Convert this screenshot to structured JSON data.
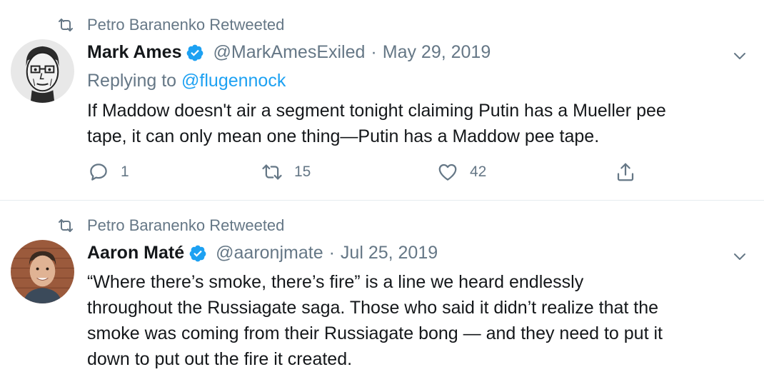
{
  "tweets": [
    {
      "retweeted_by": "Petro Baranenko Retweeted",
      "name": "Mark Ames",
      "handle": "@MarkAmesExiled",
      "separator": "·",
      "date": "May 29, 2019",
      "replying_prefix": "Replying to ",
      "replying_mention": "@flugennock",
      "text_lines": [
        "If Maddow doesn't air a segment tonight claiming Putin has a Mueller pee",
        "tape, it can only mean one thing—Putin has a Maddow pee tape."
      ],
      "replies": "1",
      "retweets": "15",
      "likes": "42"
    },
    {
      "retweeted_by": "Petro Baranenko Retweeted",
      "name": "Aaron Maté",
      "handle": "@aaronjmate",
      "separator": "·",
      "date": "Jul 25, 2019",
      "text_lines": [
        "“Where there’s smoke, there’s fire” is a line we heard endlessly",
        "throughout the Russiagate saga. Those who said it didn’t realize that the",
        "smoke was coming from their Russiagate bong — and they need to put it",
        "down to put out the fire it created."
      ]
    }
  ],
  "icons": {
    "retweet": "retweet-icon",
    "verified": "verified-badge-icon",
    "more": "chevron-down-icon",
    "reply": "reply-icon",
    "like": "heart-icon",
    "share": "share-icon"
  },
  "colors": {
    "accent": "#1da1f2",
    "secondary_text": "#657786",
    "primary_text": "#14171a",
    "divider": "#e6ecf0"
  }
}
